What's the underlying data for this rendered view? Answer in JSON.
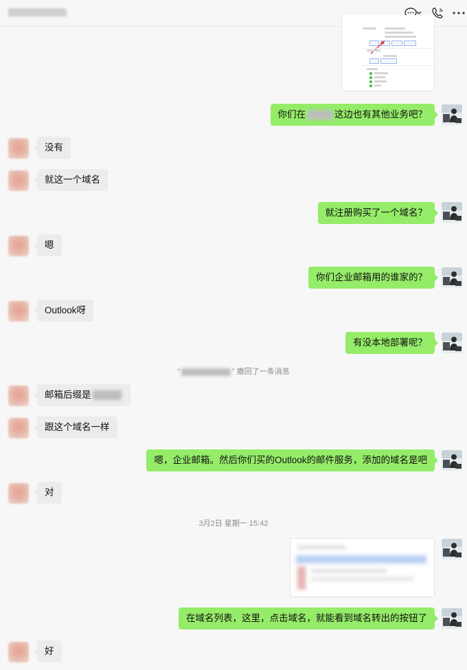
{
  "header": {
    "icons": [
      "chat-icon",
      "chevron-down-icon",
      "phone-icon",
      "more-icon"
    ]
  },
  "messages": {
    "m1": "你们在",
    "m1b": "这边也有其他业务吧？",
    "m2": "没有",
    "m3": "就这一个域名",
    "m4": "就注册购买了一个域名？",
    "m5": "嗯",
    "m6": "你们企业邮箱用的谁家的？",
    "m7": "Outlook呀",
    "m8": "有没本地部署呢？",
    "m9": "邮箱后缀是",
    "m10": "跟这个域名一样",
    "m11": "嗯，企业邮箱。然后你们买的Outlook的邮件服务，添加的域名是吧",
    "m12": "对",
    "m13": "在域名列表，这里，点击域名，就能看到域名转出的按钮了",
    "m14": "好"
  },
  "system": {
    "recall_open": "“",
    "recall_close": "”",
    "recall_text": "撤回了一条消息",
    "timestamp": "3月2日 星期一 15:42"
  }
}
